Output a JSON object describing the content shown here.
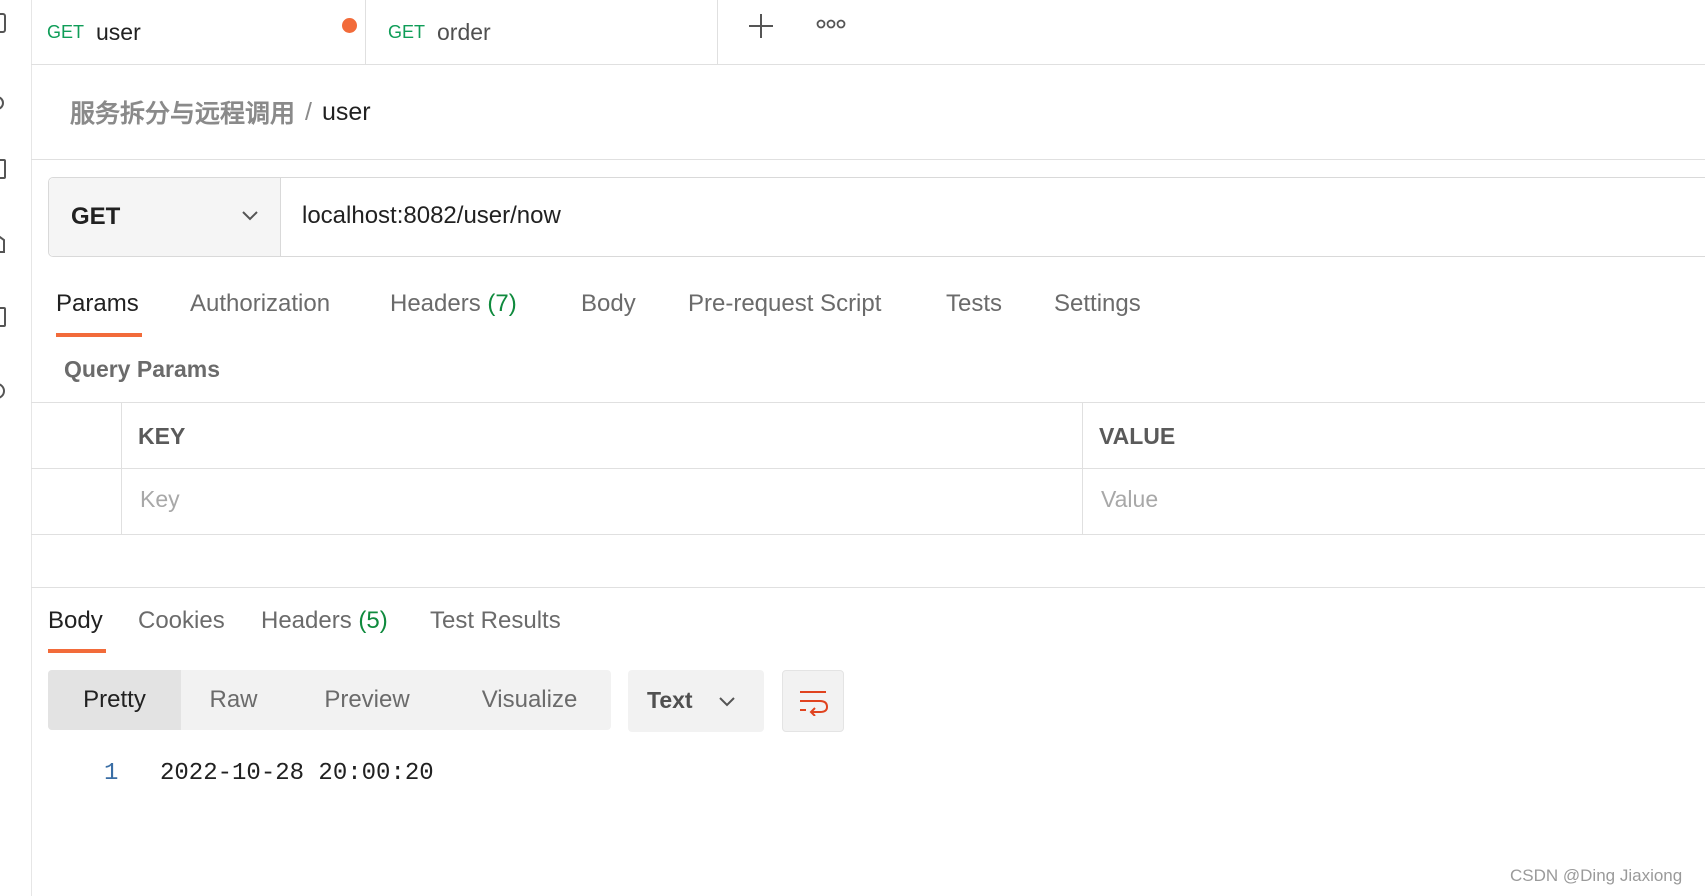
{
  "tabs": [
    {
      "method": "GET",
      "name": "user",
      "active": true,
      "unsaved": true
    },
    {
      "method": "GET",
      "name": "order",
      "active": false,
      "unsaved": false
    }
  ],
  "breadcrumb": {
    "parent": "服务拆分与远程调用",
    "separator": "/",
    "current": "user"
  },
  "request": {
    "method": "GET",
    "url": "localhost:8082/user/now"
  },
  "request_tabs": [
    {
      "label": "Params",
      "count": ""
    },
    {
      "label": "Authorization",
      "count": ""
    },
    {
      "label": "Headers",
      "count": "(7)"
    },
    {
      "label": "Body",
      "count": ""
    },
    {
      "label": "Pre-request Script",
      "count": ""
    },
    {
      "label": "Tests",
      "count": ""
    },
    {
      "label": "Settings",
      "count": ""
    }
  ],
  "query_params": {
    "title": "Query Params",
    "key_header": "KEY",
    "value_header": "VALUE",
    "key_placeholder": "Key",
    "value_placeholder": "Value"
  },
  "response_tabs": [
    {
      "label": "Body",
      "count": ""
    },
    {
      "label": "Cookies",
      "count": ""
    },
    {
      "label": "Headers",
      "count": "(5)"
    },
    {
      "label": "Test Results",
      "count": ""
    }
  ],
  "view_modes": [
    "Pretty",
    "Raw",
    "Preview",
    "Visualize"
  ],
  "format": "Text",
  "response_body": {
    "line_number": "1",
    "content": "2022-10-28 20:00:20"
  },
  "watermark": "CSDN @Ding Jiaxiong",
  "colors": {
    "accent": "#f26b3a",
    "method_get": "#0f9d58",
    "count_green": "#0f8a3d"
  },
  "icons": [
    "plus-icon",
    "more-options-icon",
    "chevron-down-icon",
    "wrap-lines-icon"
  ]
}
